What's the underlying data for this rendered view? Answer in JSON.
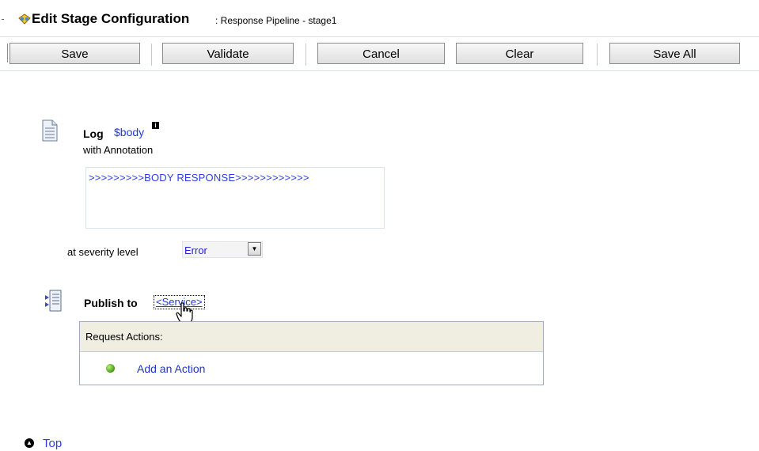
{
  "header": {
    "title": "Edit Stage Configuration",
    "subtitle": ": Response Pipeline - stage1",
    "icon": "stage-config-icon"
  },
  "toolbar": {
    "save_label": "Save",
    "validate_label": "Validate",
    "cancel_label": "Cancel",
    "clear_label": "Clear",
    "save_all_label": "Save All"
  },
  "log_action": {
    "label": "Log",
    "variable_link": "$body",
    "info_badge": "i",
    "annotation_label": "with Annotation",
    "annotation_text": ">>>>>>>>>BODY RESPONSE>>>>>>>>>>>>",
    "severity_label": "at severity level",
    "severity_value": "Error"
  },
  "publish_action": {
    "label": "Publish to",
    "service_link": "<Service>",
    "request_actions_label": "Request Actions:",
    "add_action_label": "Add an Action"
  },
  "footer": {
    "top_label": "Top"
  },
  "colors": {
    "link": "#243bd1",
    "annotation_text": "#2f3ce6",
    "request_header_bg": "#f0ede1",
    "request_border": "#a0aab8",
    "status_green": "#4c9f1f"
  }
}
